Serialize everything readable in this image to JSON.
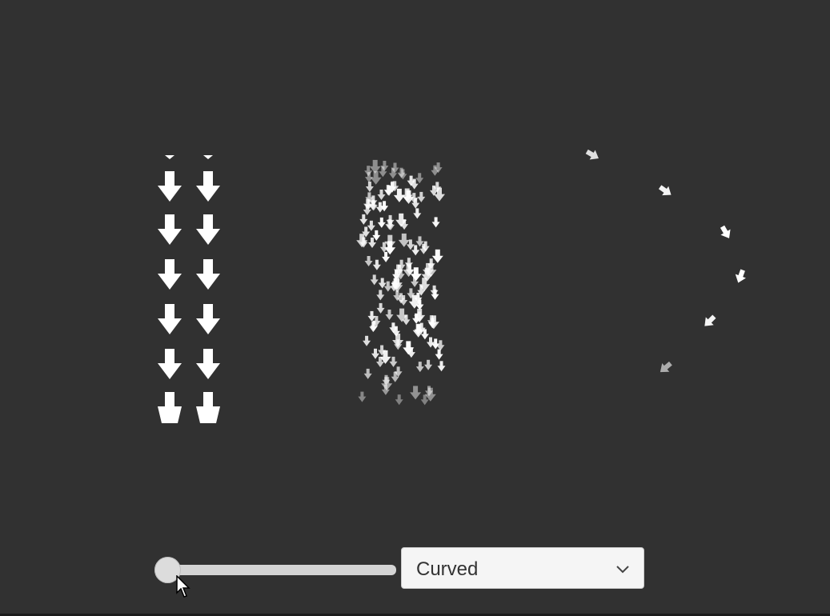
{
  "scene": {
    "panels": [
      {
        "name": "linear-grid"
      },
      {
        "name": "random-spray"
      },
      {
        "name": "curved-arc"
      }
    ]
  },
  "controls": {
    "slider": {
      "value": 0.0
    },
    "dropdown": {
      "selected": "Curved",
      "icon": "chevron-down-icon"
    }
  },
  "colors": {
    "background": "#313131",
    "arrow": "#ffffff",
    "control": "#f5f5f5"
  }
}
